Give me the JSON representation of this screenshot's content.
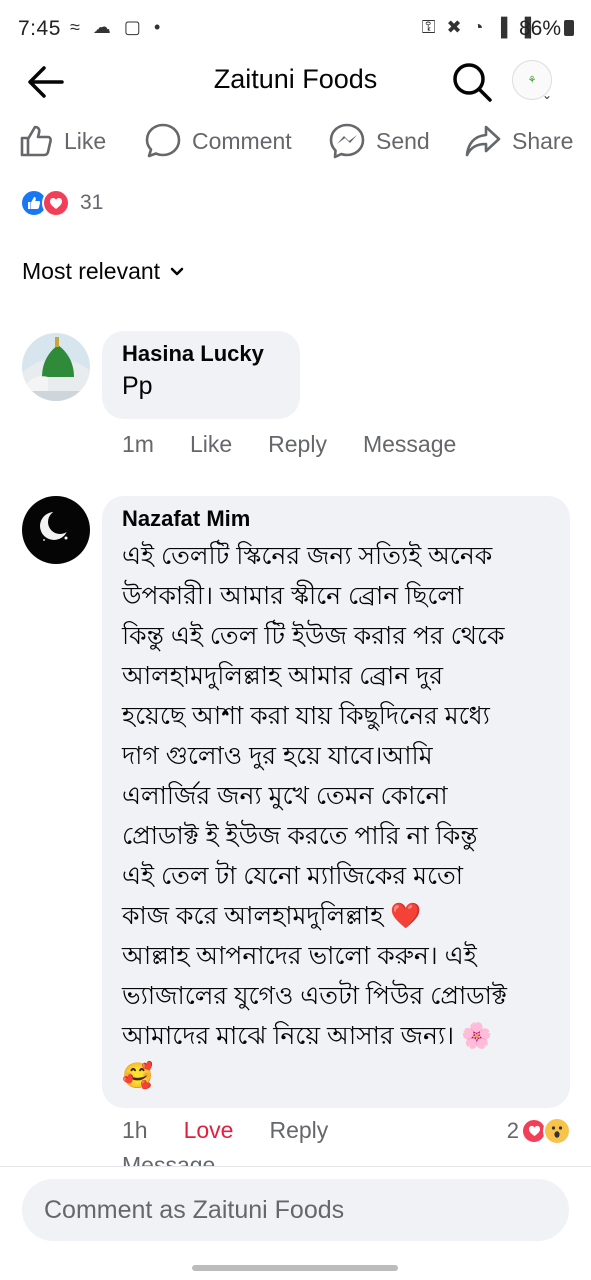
{
  "status_bar": {
    "time": "7:45",
    "battery_percent": "86%",
    "icons": [
      "link-icon",
      "cloud-icon",
      "instagram-icon",
      "dot-icon",
      "key-icon",
      "mute-icon",
      "wifi-icon",
      "signal-icon",
      "signal-icon",
      "battery-icon"
    ]
  },
  "header": {
    "title": "Zaituni Foods",
    "icons": [
      "back-arrow-icon",
      "search-icon",
      "page-avatar",
      "chevron-down-icon"
    ]
  },
  "actions": {
    "like": "Like",
    "comment": "Comment",
    "send": "Send",
    "share": "Share"
  },
  "reactions": {
    "types": [
      "like",
      "love"
    ],
    "count": "31"
  },
  "sort": {
    "label": "Most relevant"
  },
  "comments": [
    {
      "author": "Hasina Lucky",
      "text": "Pp",
      "time": "1m",
      "like": "Like",
      "reply": "Reply",
      "message": "Message"
    },
    {
      "author": "Nazafat Mim",
      "lines": [
        "এই তেলটি স্কিনের জন্য সত্যিই অনেক",
        "উপকারী। আমার স্কীনে ব্রোন ছিলো",
        "কিন্তু এই তেল টি ইউজ করার পর থেকে",
        "আলহামদুলিল্লাহ আমার ব্রোন দুর",
        "হয়েছে আশা করা যায় কিছুদিনের মধ্যে",
        "দাগ গুলোও দুর হয়ে যাবে।আমি",
        "এলার্জির জন্য মুখে তেমন কোনো",
        "প্রোডাক্ট ই ইউজ করতে পারি না কিন্তু",
        "এই তেল টা যেনো ম্যাজিকের মতো",
        "কাজ করে আলহামদুলিল্লাহ ❤️",
        "আল্লাহ আপনাদের ভালো করুন। এই",
        "ভ্যাজালের যুগেও এতটা পিউর প্রোডাক্ট",
        "আমাদের মাঝে নিয়ে আসার জন্য। 🌸",
        "🥰"
      ],
      "time": "1h",
      "love": "Love",
      "reply": "Reply",
      "message": "Message",
      "reaction_count": "2",
      "reaction_types": [
        "love",
        "wow"
      ]
    }
  ],
  "composer": {
    "placeholder": "Comment as Zaituni Foods"
  },
  "colors": {
    "like_blue": "#1877f2",
    "love_red": "#e41e3f",
    "bubble_gray": "#f0f2f5",
    "secondary_text": "#65676b"
  }
}
